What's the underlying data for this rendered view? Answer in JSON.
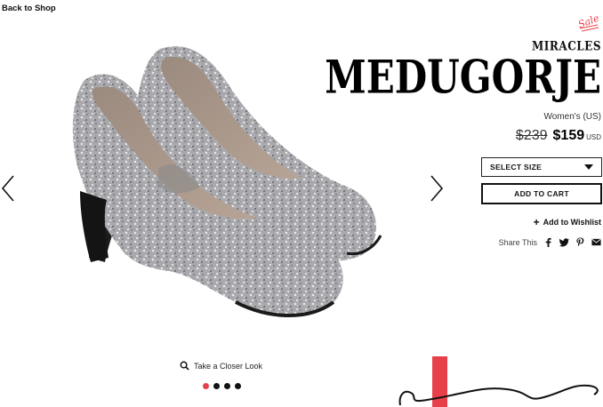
{
  "nav": {
    "back_label": "Back to Shop"
  },
  "gallery": {
    "closer_look_label": "Take a Closer Look",
    "image_count": 4,
    "active_index": 0
  },
  "product": {
    "badge_text": "Sale",
    "brand": "MIRACLES",
    "title": "MEDUGORJE",
    "gender": "Women's (US)",
    "old_price": "$239",
    "new_price": "$159",
    "currency": "USD"
  },
  "actions": {
    "select_size_label": "SELECT SIZE",
    "add_to_cart_label": "ADD TO CART",
    "wishlist_label": "Add to Wishlist",
    "share_label": "Share This"
  },
  "colors": {
    "accent": "#e8404a",
    "text": "#111111"
  },
  "icons": [
    "search-icon",
    "facebook-icon",
    "twitter-icon",
    "pinterest-icon",
    "email-icon",
    "chevron-left-icon",
    "chevron-right-icon"
  ]
}
